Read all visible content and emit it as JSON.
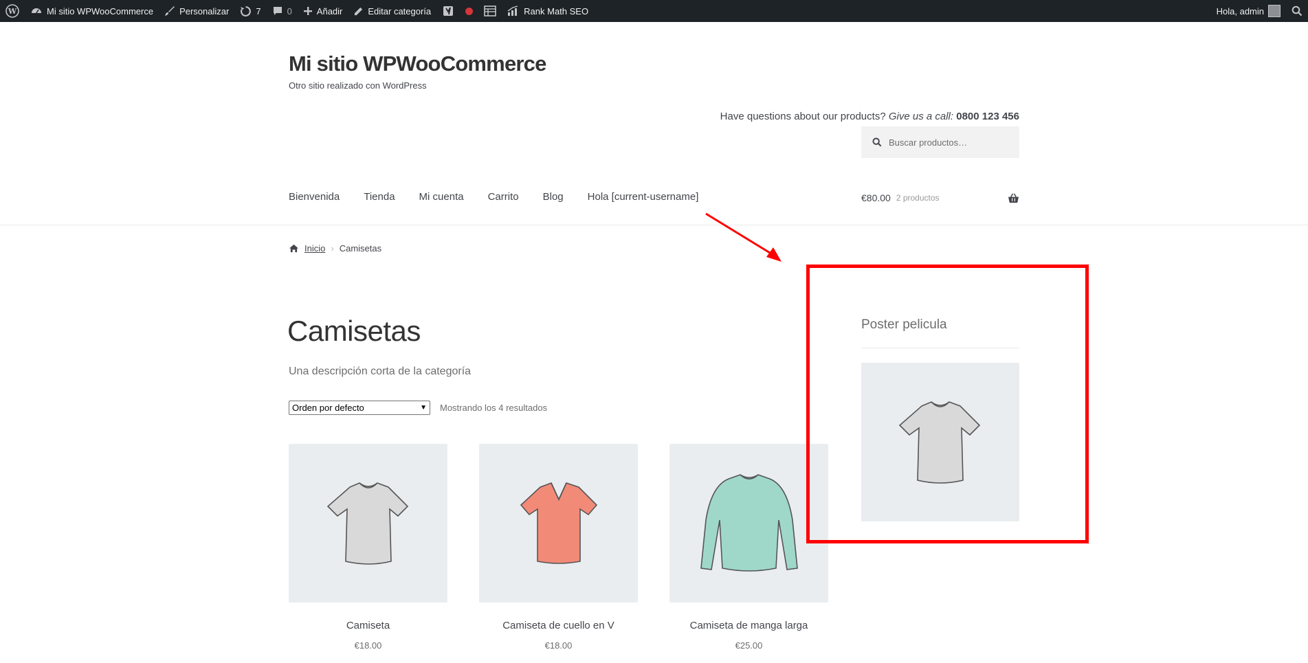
{
  "adminbar": {
    "site_name": "Mi sitio WPWooCommerce",
    "customize": "Personalizar",
    "updates_count": "7",
    "comments_count": "0",
    "add_new": "Añadir",
    "edit_category": "Editar categoría",
    "rank_math": "Rank Math SEO",
    "greeting": "Hola, admin"
  },
  "header": {
    "site_title": "Mi sitio WPWooCommerce",
    "tagline": "Otro sitio realizado con WordPress",
    "contact_prefix": "Have questions about our products?",
    "contact_italic": "Give us a call:",
    "contact_phone": "0800 123 456",
    "search_placeholder": "Buscar productos…"
  },
  "nav": {
    "items": [
      "Bienvenida",
      "Tienda",
      "Mi cuenta",
      "Carrito",
      "Blog",
      "Hola [current-username]"
    ]
  },
  "cart": {
    "total": "€80.00",
    "count": "2 productos"
  },
  "breadcrumb": {
    "home": "Inicio",
    "current": "Camisetas"
  },
  "main": {
    "title": "Camisetas",
    "description": "Una descripción corta de la categoría",
    "orderby": "Orden por defecto",
    "result_count": "Mostrando los 4 resultados",
    "products": [
      {
        "name": "Camiseta",
        "price": "€18.00",
        "color": "#d9d9d9"
      },
      {
        "name": "Camiseta de cuello en V",
        "price": "€18.00",
        "color": "#f28a78"
      },
      {
        "name": "Camiseta de manga larga",
        "price": "€25.00",
        "color": "#9fd8c8"
      }
    ]
  },
  "sidebar": {
    "widget_title": "Poster pelicula",
    "image_color": "#d9d9d9"
  },
  "annotation": {
    "color": "#ff0000"
  }
}
